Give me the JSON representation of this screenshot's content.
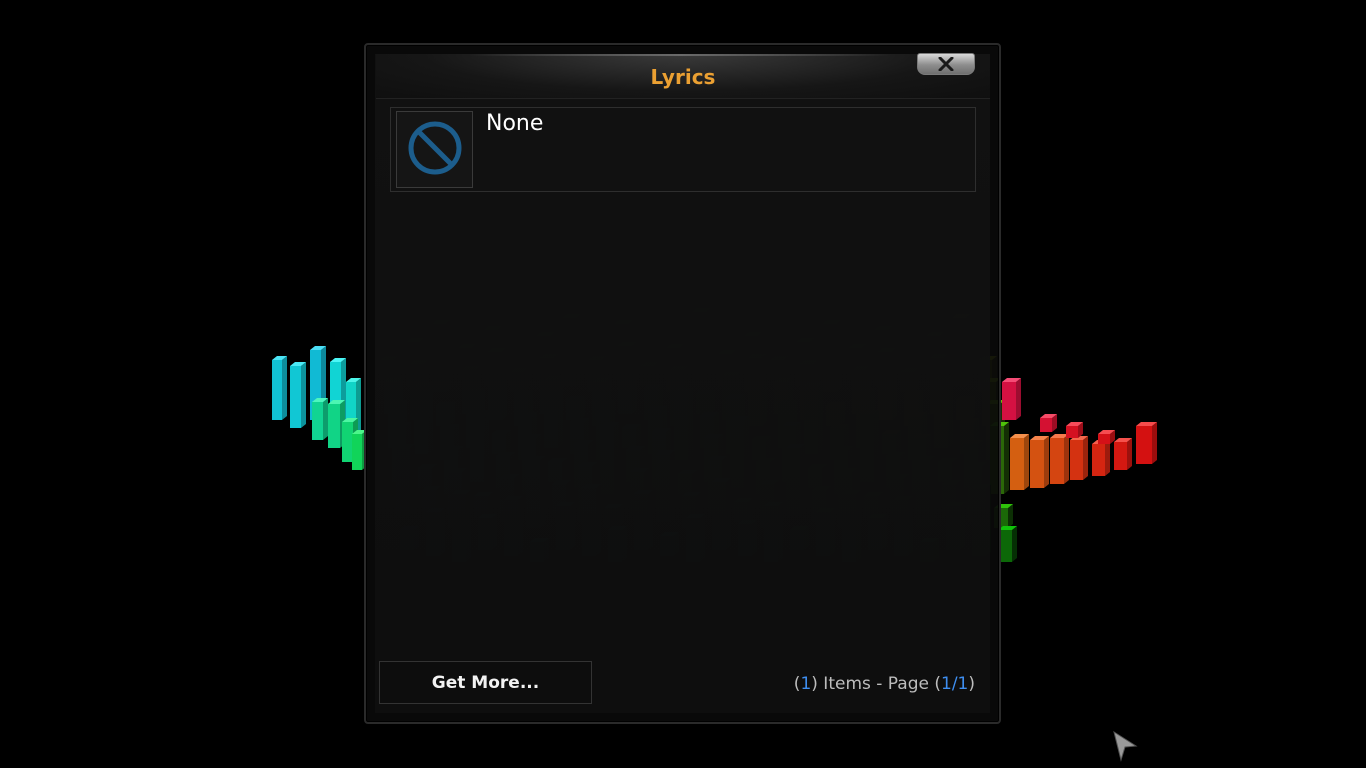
{
  "dialog": {
    "title": "Lyrics",
    "close_icon": "close-icon",
    "items": [
      {
        "label": "None",
        "icon": "none-icon"
      }
    ],
    "get_more_label": "Get More...",
    "footer": {
      "open_paren": "(",
      "items_count": "1",
      "items_text": ") Items - Page (",
      "page": "1/1",
      "close_paren": ")"
    }
  },
  "colors": {
    "title": "#eba032",
    "accent_number": "#3e8ef0",
    "icon_blue": "#1c5d8c"
  }
}
